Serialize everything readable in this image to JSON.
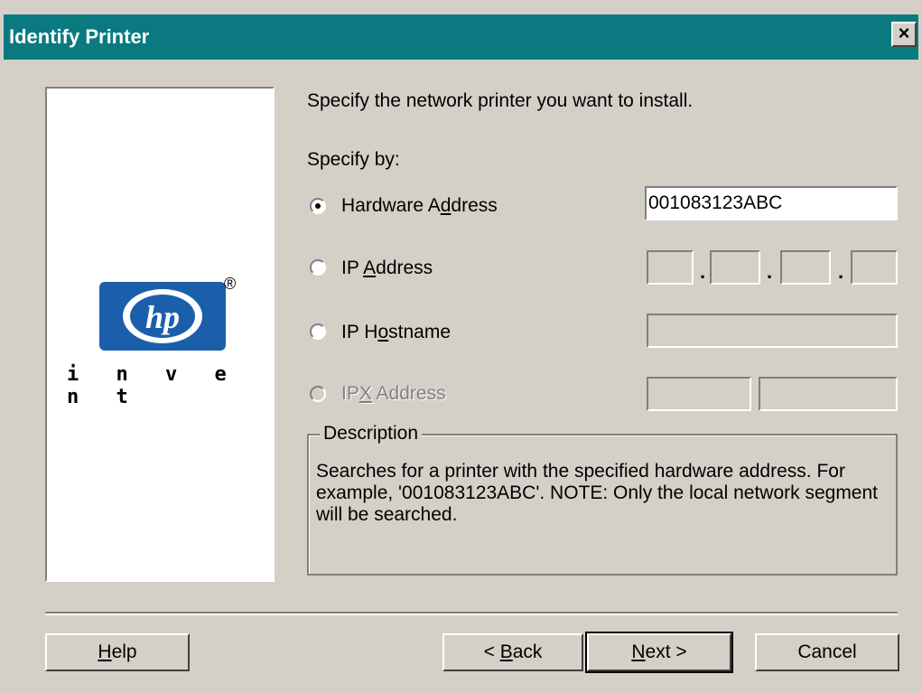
{
  "window": {
    "title": "Identify Printer",
    "close_glyph": "×"
  },
  "logo": {
    "brand": "hp",
    "registered": "®",
    "tagline": "i n v e n t"
  },
  "intro": "Specify the network printer you want to install.",
  "specify_by_label": "Specify by:",
  "options": [
    {
      "label_pre": "Hardware A",
      "accel": "d",
      "label_post": "dress",
      "selected": true,
      "enabled": true,
      "value": "001083123ABC"
    },
    {
      "label_pre": "IP ",
      "accel": "A",
      "label_post": "ddress",
      "selected": false,
      "enabled": true,
      "value": ""
    },
    {
      "label_pre": "IP H",
      "accel": "o",
      "label_post": "stname",
      "selected": false,
      "enabled": true,
      "value": ""
    },
    {
      "label_pre": "IP",
      "accel": "X",
      "label_post": " Address",
      "selected": false,
      "enabled": false,
      "value": ""
    }
  ],
  "ip_separator": ".",
  "description": {
    "legend": "Description",
    "text": "Searches for a printer with the specified hardware address. For example, '001083123ABC'.  NOTE: Only the local network segment will be searched."
  },
  "buttons": {
    "help": {
      "accel": "H",
      "rest": "elp"
    },
    "back": {
      "pre": "< ",
      "accel": "B",
      "rest": "ack"
    },
    "next": {
      "accel": "N",
      "rest": "ext >"
    },
    "cancel": "Cancel"
  },
  "colors": {
    "titlebar": "#0a7a80",
    "face": "#d4d0c8",
    "hp_blue": "#1b5faa"
  }
}
